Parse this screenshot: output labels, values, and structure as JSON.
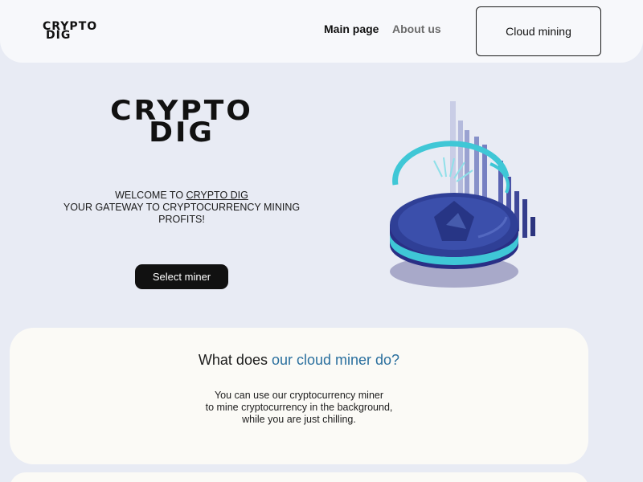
{
  "header": {
    "logo_line1": "CRYPTO",
    "logo_line2": "DIG",
    "nav": {
      "main_page": "Main page",
      "about_us": "About us"
    },
    "cloud_mining_button": "Cloud mining"
  },
  "hero": {
    "logo_line1": "CRYPTO",
    "logo_line2": "DIG",
    "welcome_prefix": "WELCOME TO ",
    "welcome_brand": "CRYPTO DIG",
    "tagline": "YOUR GATEWAY TO CRYPTOCURRENCY MINING PROFITS!",
    "select_miner_button": "Select miner",
    "illustration": "crypto-coin-illustration"
  },
  "info_card": {
    "title_prefix": "What does ",
    "title_accent": "our cloud miner do?",
    "text_line1": "You can use our cryptocurrency miner",
    "text_line2": "to mine cryptocurrency in the background,",
    "text_line3": "while you are just chilling."
  },
  "colors": {
    "background": "#e8ebf4",
    "header_bg": "#f7f8fb",
    "card_bg": "#fbfaf6",
    "accent_blue": "#2a6f9e",
    "button_dark": "#111111",
    "coin_blue": "#2b3a8f",
    "coin_cyan": "#3fc7d6"
  }
}
